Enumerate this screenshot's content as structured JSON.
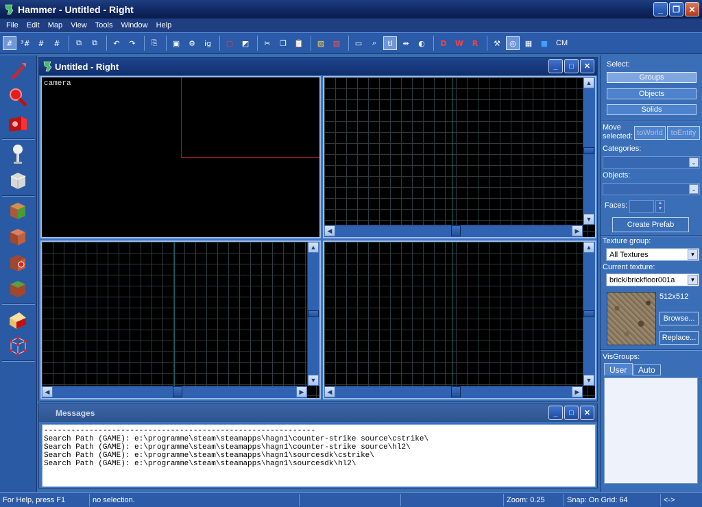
{
  "window": {
    "title": "Hammer - Untitled - Right"
  },
  "menubar": [
    "File",
    "Edit",
    "Map",
    "View",
    "Tools",
    "Window",
    "Help"
  ],
  "toolbar": {
    "cm_label": "CM"
  },
  "map_window": {
    "title": "Untitled - Right",
    "camera_label": "camera"
  },
  "messages": {
    "title": "Messages",
    "lines": [
      "------------------------------------------------------------",
      "Search Path (GAME): e:\\programme\\steam\\steamapps\\hagn1\\counter-strike source\\cstrike\\",
      "Search Path (GAME): e:\\programme\\steam\\steamapps\\hagn1\\counter-strike source\\hl2\\",
      "Search Path (GAME): e:\\programme\\steam\\steamapps\\hagn1\\sourcesdk\\cstrike\\",
      "Search Path (GAME): e:\\programme\\steam\\steamapps\\hagn1\\sourcesdk\\hl2\\"
    ]
  },
  "right_panel": {
    "select_label": "Select:",
    "groups": "Groups",
    "objects_btn": "Objects",
    "solids": "Solids",
    "move_selected": "Move selected:",
    "to_world": "toWorld",
    "to_entity": "toEntity",
    "categories": "Categories:",
    "objects_label": "Objects:",
    "faces": "Faces:",
    "create_prefab": "Create Prefab",
    "texture_group_label": "Texture group:",
    "texture_group_value": "All Textures",
    "current_texture_label": "Current texture:",
    "current_texture_value": "brick/brickfloor001a",
    "texture_size": "512x512",
    "browse": "Browse...",
    "replace": "Replace...",
    "visgroups_label": "VisGroups:",
    "tab_user": "User",
    "tab_auto": "Auto"
  },
  "statusbar": {
    "help": "For Help, press F1",
    "selection": "no selection.",
    "zoom": "Zoom: 0.25",
    "snap": "Snap: On Grid: 64",
    "arrows": "<->"
  }
}
